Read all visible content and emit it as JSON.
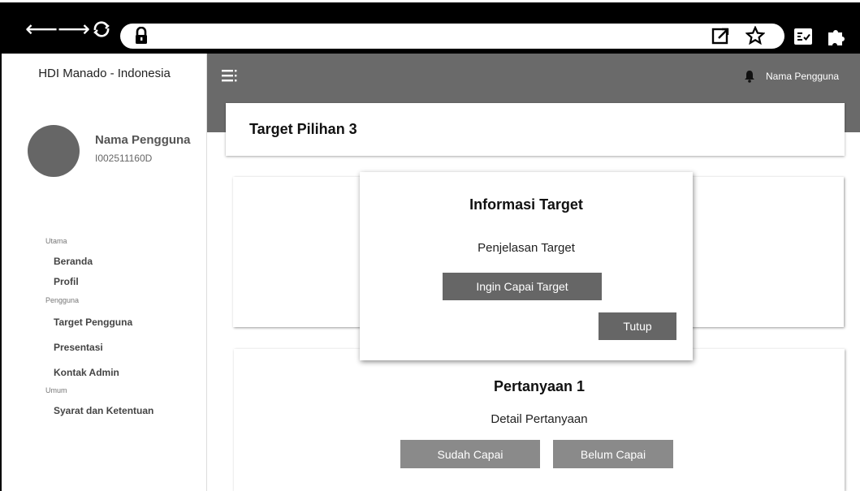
{
  "browser": {
    "nav": {
      "back": "⟵",
      "forward": "⟶"
    }
  },
  "sidebar": {
    "brand": "HDI Manado - Indonesia",
    "user": {
      "name": "Nama Pengguna",
      "id": "I002511160D"
    },
    "sections": [
      {
        "label": "Utama",
        "items": [
          "Beranda",
          "Profil"
        ]
      },
      {
        "label": "Pengguna",
        "items": [
          "Target Pengguna",
          "Presentasi",
          "Kontak Admin"
        ]
      },
      {
        "label": "Umum",
        "items": [
          "Syarat dan Ketentuan"
        ]
      }
    ]
  },
  "header": {
    "user_label": "Nama Pengguna",
    "icons": [
      "menu-icon",
      "bell-icon"
    ]
  },
  "page": {
    "title": "Target Pilihan 3"
  },
  "modal": {
    "title": "Informasi Target",
    "description": "Penjelasan Target",
    "primary_button": "Ingin Capai Target",
    "close_button": "Tutup"
  },
  "question": {
    "title": "Pertanyaan 1",
    "detail": "Detail Pertanyaan",
    "done_button": "Sudah Capai",
    "not_done_button": "Belum Capai"
  },
  "colors": {
    "header_bg": "#6a6a6a",
    "button_dark": "#666666",
    "button_mid": "#8a8a8a",
    "browser_bar": "#000000"
  }
}
